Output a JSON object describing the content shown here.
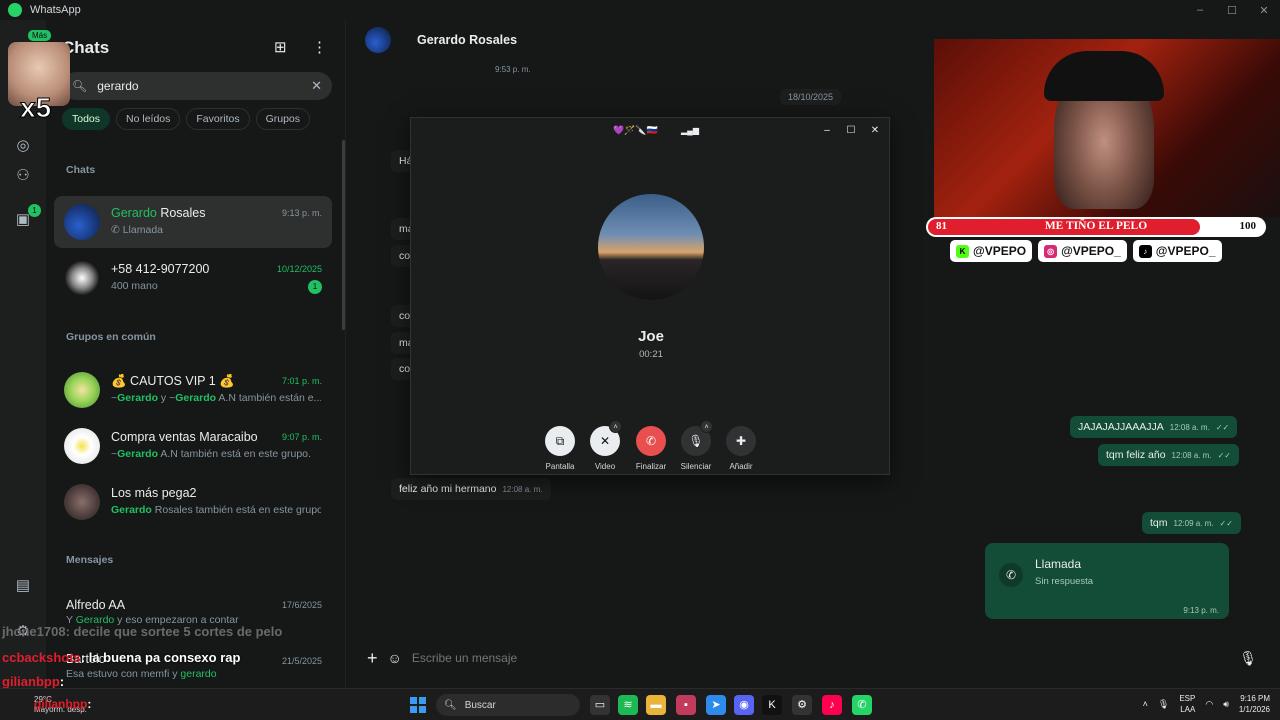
{
  "window": {
    "title": "WhatsApp"
  },
  "sidebar": {
    "title": "Chats",
    "search": {
      "value": "gerardo"
    },
    "filters": [
      "Todos",
      "No leídos",
      "Favoritos",
      "Grupos"
    ],
    "section_chats": "Chats",
    "section_groups": "Grupos en común",
    "section_messages": "Mensajes",
    "chats": [
      {
        "name_hl": "Gerardo",
        "name_rest": " Rosales",
        "sub": "Llamada",
        "time": "9:13 p. m."
      },
      {
        "name": "+58 412-9077200",
        "sub": "400 mano",
        "time": "10/12/2025",
        "unread": "1"
      }
    ],
    "groups": [
      {
        "name": "💰 CAUTOS VIP 1 💰",
        "sub_a": "~",
        "sub_b": "Gerardo",
        "sub_c": " y ~",
        "sub_d": "Gerardo",
        "sub_e": " A.N también están e...",
        "time": "7:01 p. m."
      },
      {
        "name": "Compra ventas Maracaibo",
        "sub_a": "~",
        "sub_b": "Gerardo",
        "sub_c": " A.N también está en este grupo.",
        "time": "9:07 p. m."
      },
      {
        "name": "Los más pega2",
        "sub_b": "Gerardo",
        "sub_c": " Rosales también está en este grupo."
      }
    ],
    "messages": [
      {
        "name": "Alfredo AA",
        "sub_a": "Y ",
        "sub_b": "Gerardo",
        "sub_c": " y eso empezaron a contar",
        "time": "17/6/2025"
      },
      {
        "name": "Bartolo",
        "sub_a": "Esa estuvo con memfi y ",
        "sub_b": "gerardo",
        "time": "21/5/2025"
      }
    ]
  },
  "rail": {
    "badge_updates": "1"
  },
  "chat": {
    "contact": "Gerardo Rosales",
    "time_top": "9:53 p. m.",
    "date_chip": "18/10/2025",
    "left_fragments": [
      "Há",
      "ma",
      "co",
      "co",
      "ma",
      "co"
    ],
    "incoming": {
      "text": "feliz año mi hermano",
      "time": "12:08 a. m."
    },
    "outgoing": [
      {
        "text": "JAJAJAJJAAAJJA",
        "time": "12:08 a. m."
      },
      {
        "text": "tqm feliz año",
        "time": "12:08 a. m."
      },
      {
        "text": "tqm",
        "time": "12:09 a. m."
      }
    ],
    "call": {
      "title": "Llamada",
      "status": "Sin respuesta",
      "time": "9:13 p. m."
    },
    "composer_placeholder": "Escribe un mensaje"
  },
  "call_window": {
    "emojis": "💜🪄🔪🇷🇺",
    "name": "Joe",
    "duration": "00:21",
    "buttons": [
      "Pantalla",
      "Video",
      "Finalizar",
      "Silenciar",
      "Añadir"
    ]
  },
  "stream": {
    "mas": "Más",
    "x5": "x5",
    "goal_label": "ME TIÑO EL PELO",
    "goal_current": "81",
    "goal_target": "100",
    "goal_fraction": 0.81,
    "handles": [
      "@VPEPO",
      "@VPEPO_",
      "@VPEPO_"
    ],
    "chat_lines": [
      {
        "user": "jhone1708",
        "msg": ": decile que sortee 5 cortes de pelo",
        "color": "#6a6a6a"
      },
      {
        "user": "ccbackshots",
        "msg": ": la buena pa consexo rap",
        "color": "#e01e2d"
      },
      {
        "user": "gilianbpp",
        "msg": ":",
        "color": "#e01e2d"
      },
      {
        "user": "gilianbpp",
        "msg": ":",
        "color": "#e01e2d"
      }
    ]
  },
  "taskbar": {
    "weather_temp": "29°C",
    "weather_desc": "Mayorm. desp.",
    "search": "Buscar",
    "lang": "ESP",
    "lang2": "LAA",
    "time": "9:16 PM",
    "date": "1/1/2026"
  },
  "colors": {
    "accent": "#21c063",
    "outgoing": "#144d37",
    "end_call": "#ea4f4f",
    "goal_bar": "#e01e2d"
  }
}
